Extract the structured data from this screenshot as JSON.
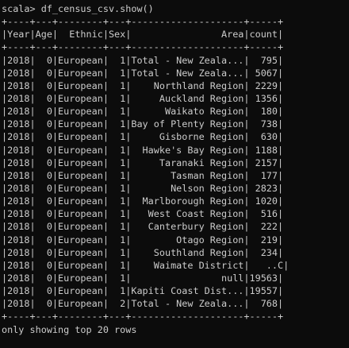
{
  "prompt": {
    "text": "scala> ",
    "command": "df_census_csv.show()"
  },
  "table": {
    "border_top": "+----+---+--------+---+--------------------+-----+",
    "header": "|Year|Age|  Ethnic|Sex|                Area|count|",
    "border_mid": "+----+---+--------+---+--------------------+-----+",
    "rows": [
      "|2018|  0|European|  1|Total - New Zeala...|  795|",
      "|2018|  0|European|  1|Total - New Zeala...| 5067|",
      "|2018|  0|European|  1|    Northland Region| 2229|",
      "|2018|  0|European|  1|     Auckland Region| 1356|",
      "|2018|  0|European|  1|      Waikato Region|  180|",
      "|2018|  0|European|  1|Bay of Plenty Region|  738|",
      "|2018|  0|European|  1|     Gisborne Region|  630|",
      "|2018|  0|European|  1|  Hawke's Bay Region| 1188|",
      "|2018|  0|European|  1|     Taranaki Region| 2157|",
      "|2018|  0|European|  1|       Tasman Region|  177|",
      "|2018|  0|European|  1|       Nelson Region| 2823|",
      "|2018|  0|European|  1|  Marlborough Region| 1020|",
      "|2018|  0|European|  1|   West Coast Region|  516|",
      "|2018|  0|European|  1|   Canterbury Region|  222|",
      "|2018|  0|European|  1|        Otago Region|  219|",
      "|2018|  0|European|  1|    Southland Region|  234|",
      "|2018|  0|European|  1|    Waimate District|   ..C|",
      "|2018|  0|European|  1|                null|19563|",
      "|2018|  0|European|  1|Kapiti Coast Dist...|19557|",
      "|2018|  0|European|  2|Total - New Zeala...|  768|"
    ],
    "border_bottom": "+----+---+--------+---+--------------------+-----+"
  },
  "footer": "only showing top 20 rows",
  "colors": {
    "background": "#0c0c0c",
    "text": "#cccccc"
  }
}
